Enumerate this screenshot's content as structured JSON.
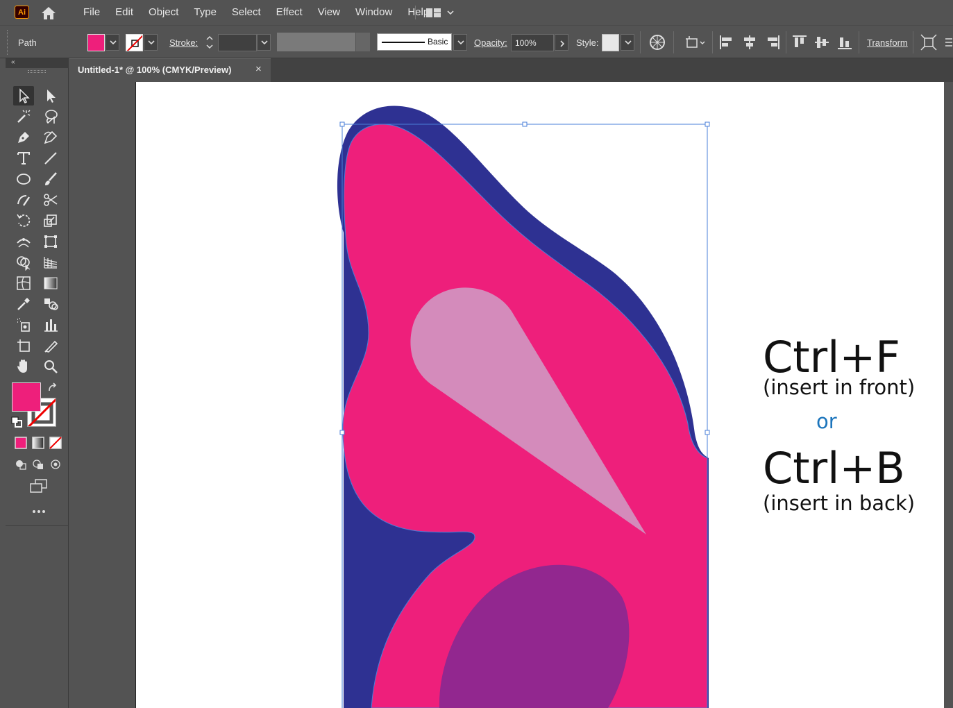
{
  "app": {
    "logo": "Ai"
  },
  "menu": [
    "File",
    "Edit",
    "Object",
    "Type",
    "Select",
    "Effect",
    "View",
    "Window",
    "Help"
  ],
  "control_bar": {
    "selection_label": "Path",
    "fill_color": "#ee1f7b",
    "stroke_label": "Stroke:",
    "brush_label": "Basic",
    "opacity_label": "Opacity:",
    "opacity_value": "100%",
    "style_label": "Style:",
    "transform_label": "Transform"
  },
  "document_tab": {
    "title": "Untitled-1* @ 100% (CMYK/Preview)",
    "close": "×"
  },
  "tools": {
    "fill_color": "#ee1f7b",
    "stroke_color": "none"
  },
  "artwork": {
    "colors": {
      "wing": "#ee1f7b",
      "outline": "#2e3192",
      "highlight": "#d48bbb",
      "spot": "#92278f",
      "selection": "#4a7fd8"
    }
  },
  "annotation": {
    "line1": "Ctrl+F",
    "line1_sub": "(insert in front)",
    "or": "or",
    "or_color": "#1c75bc",
    "line2": "Ctrl+B",
    "line2_sub": "(insert in back)"
  }
}
